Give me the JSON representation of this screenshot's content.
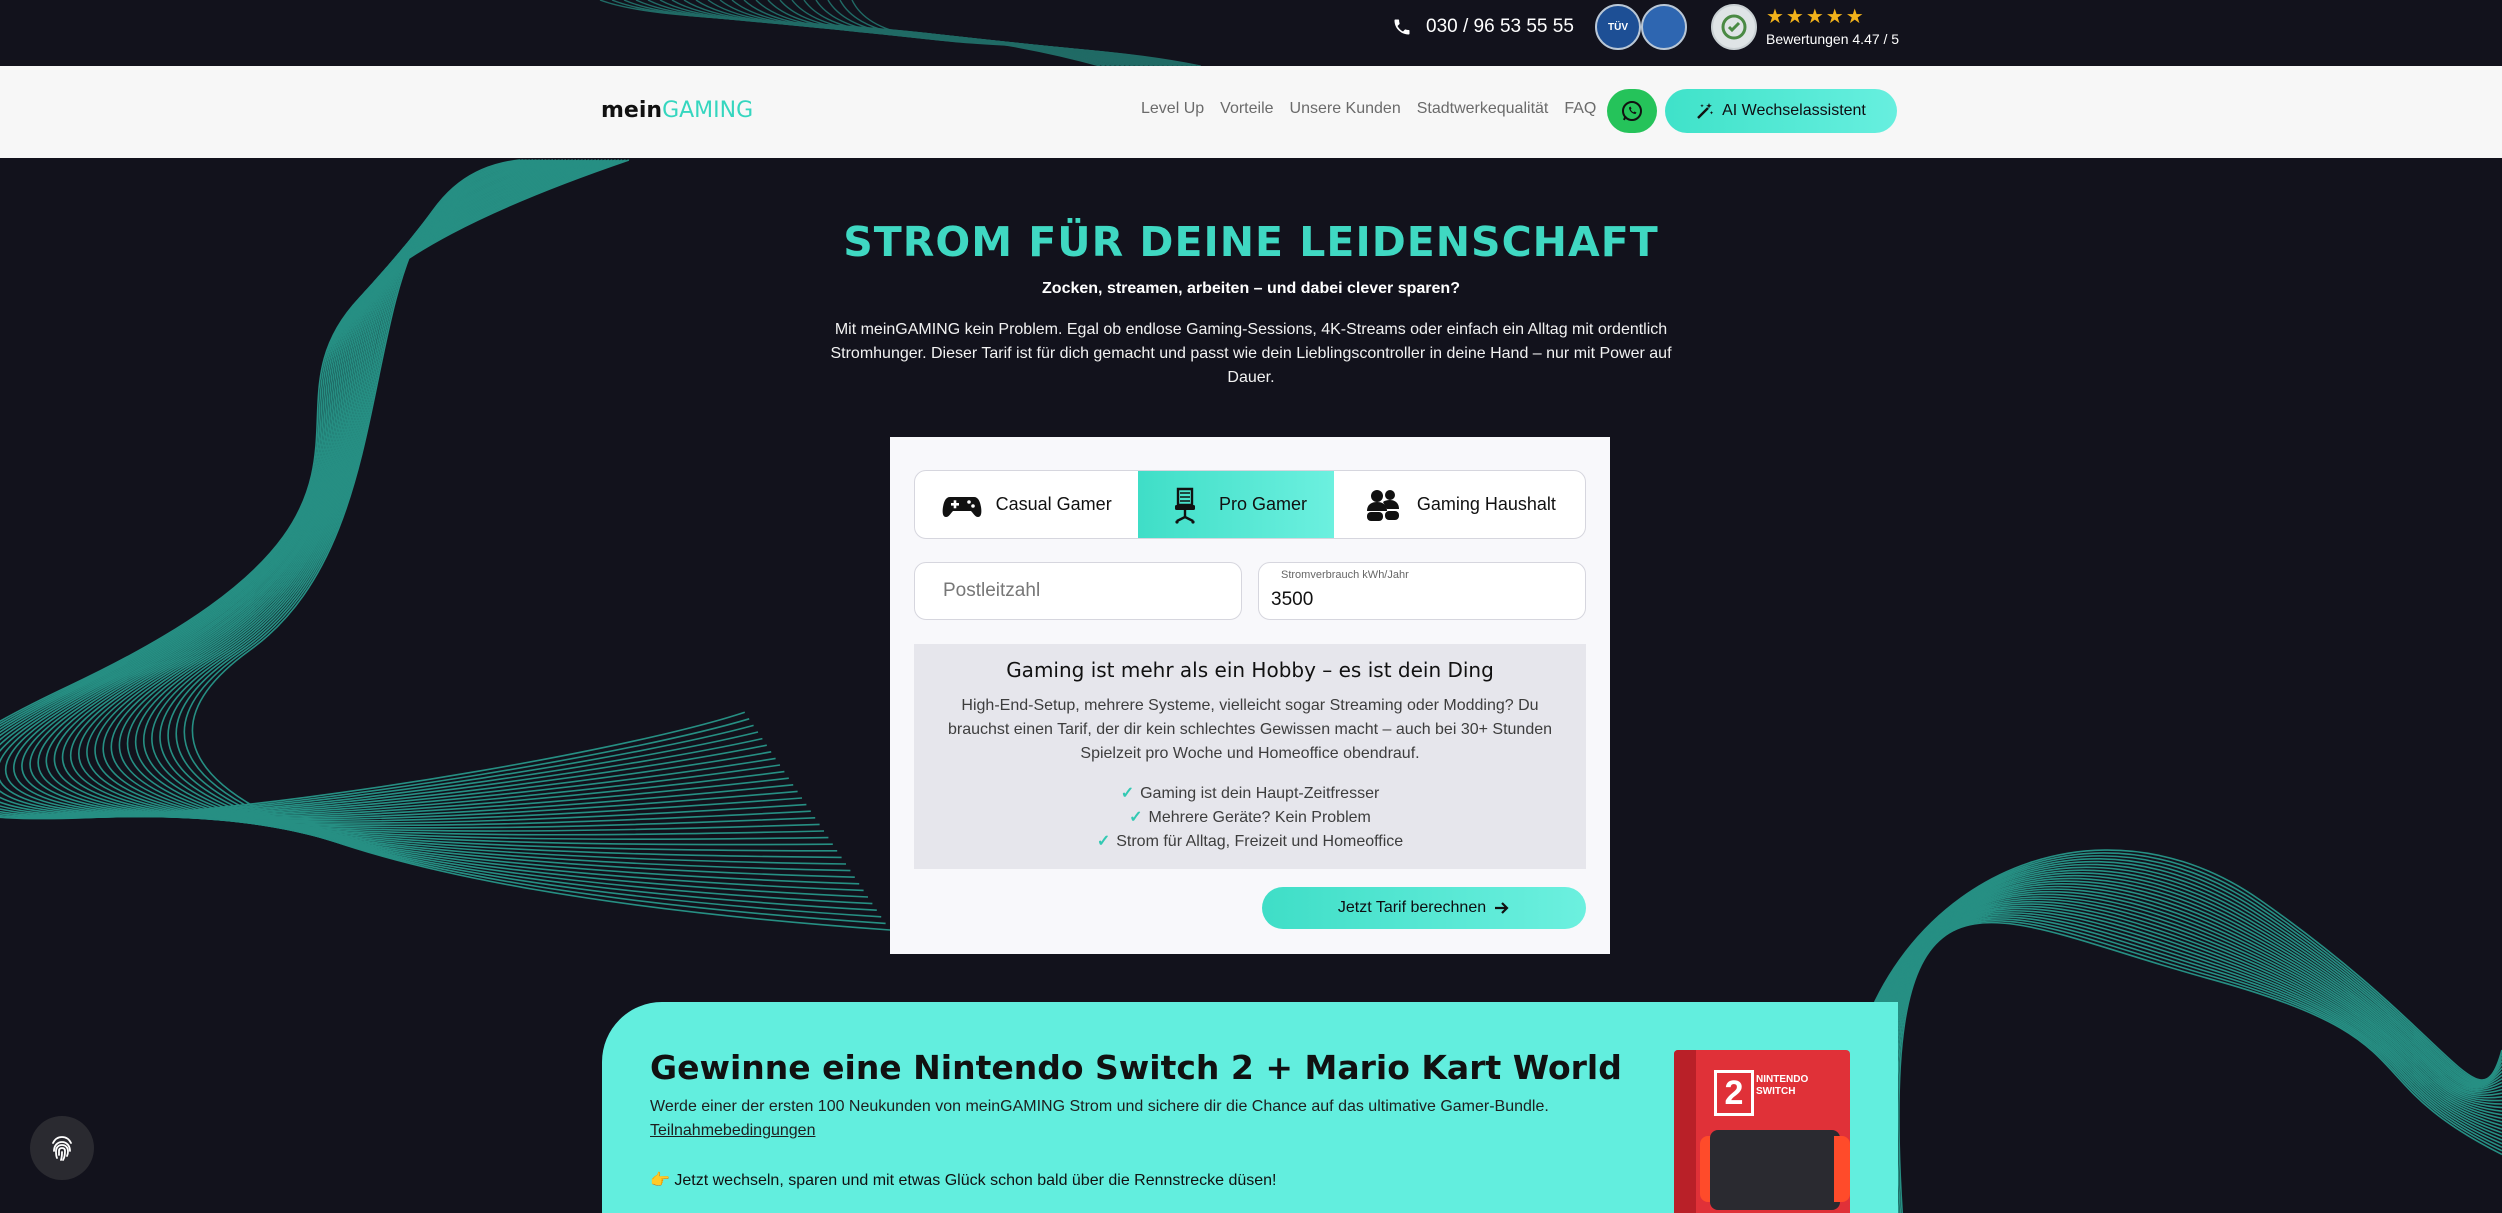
{
  "topbar": {
    "phone": "030 / 96 53 55 55",
    "seal_1": "TÜV",
    "seal_2": "",
    "rating_text": "Bewertungen 4.47 / 5",
    "stars": "★★★★★"
  },
  "nav": {
    "logo_main": "mein",
    "logo_accent": "GAMING",
    "links": [
      "Level Up",
      "Vorteile",
      "Unsere Kunden",
      "Stadtwerkequalität",
      "FAQ"
    ],
    "ai_button": "AI Wechselassistent"
  },
  "hero": {
    "title": "STROM FÜR DEINE LEIDENSCHAFT",
    "subtitle": "Zocken, streamen, arbeiten – und dabei clever sparen?",
    "text": "Mit meinGAMING kein Problem. Egal ob endlose Gaming-Sessions, 4K-Streams oder einfach ein Alltag mit ordentlich Stromhunger. Dieser Tarif ist für dich gemacht und passt wie dein Lieblingscontroller in deine Hand – nur mit Power auf Dauer."
  },
  "calculator": {
    "tabs": [
      {
        "label": "Casual Gamer",
        "icon": "gamepad-icon",
        "active": false
      },
      {
        "label": "Pro Gamer",
        "icon": "gaming-chair-icon",
        "active": true
      },
      {
        "label": "Gaming Haushalt",
        "icon": "users-icon",
        "active": false
      }
    ],
    "postcode_placeholder": "Postleitzahl",
    "consumption_label": "Stromverbrauch kWh/Jahr",
    "consumption_value": "3500",
    "info_title": "Gaming ist mehr als ein Hobby – es ist dein Ding",
    "info_text": "High-End-Setup, mehrere Systeme, vielleicht sogar Streaming oder Modding? Du brauchst einen Tarif, der dir kein schlechtes Gewissen macht – auch bei 30+ Stunden Spielzeit pro Woche und Homeoffice obendrauf.",
    "benefits": [
      "Gaming ist dein Haupt-Zeitfresser",
      "Mehrere Geräte? Kein Problem",
      "Strom für Alltag, Freizeit und Homeoffice"
    ],
    "button": "Jetzt Tarif berechnen"
  },
  "promo": {
    "title": "Gewinne eine Nintendo Switch 2 + Mario Kart World",
    "text": "Werde einer der ersten 100 Neukunden von meinGAMING Strom und sichere dir die Chance auf das ultimative Gamer-Bundle.",
    "link": "Teilnahmebedingungen",
    "cta": "Jetzt wechseln, sparen und mit etwas Glück schon bald über die Rennstrecke düsen!",
    "cta_emoji": "👉",
    "product_number": "2",
    "product_name": "NINTENDO SWITCH"
  },
  "colors": {
    "accent": "#3fd8c2",
    "background": "#12121c",
    "promo": "#62eede",
    "whatsapp": "#25c35a",
    "stars": "#f2b21b"
  }
}
